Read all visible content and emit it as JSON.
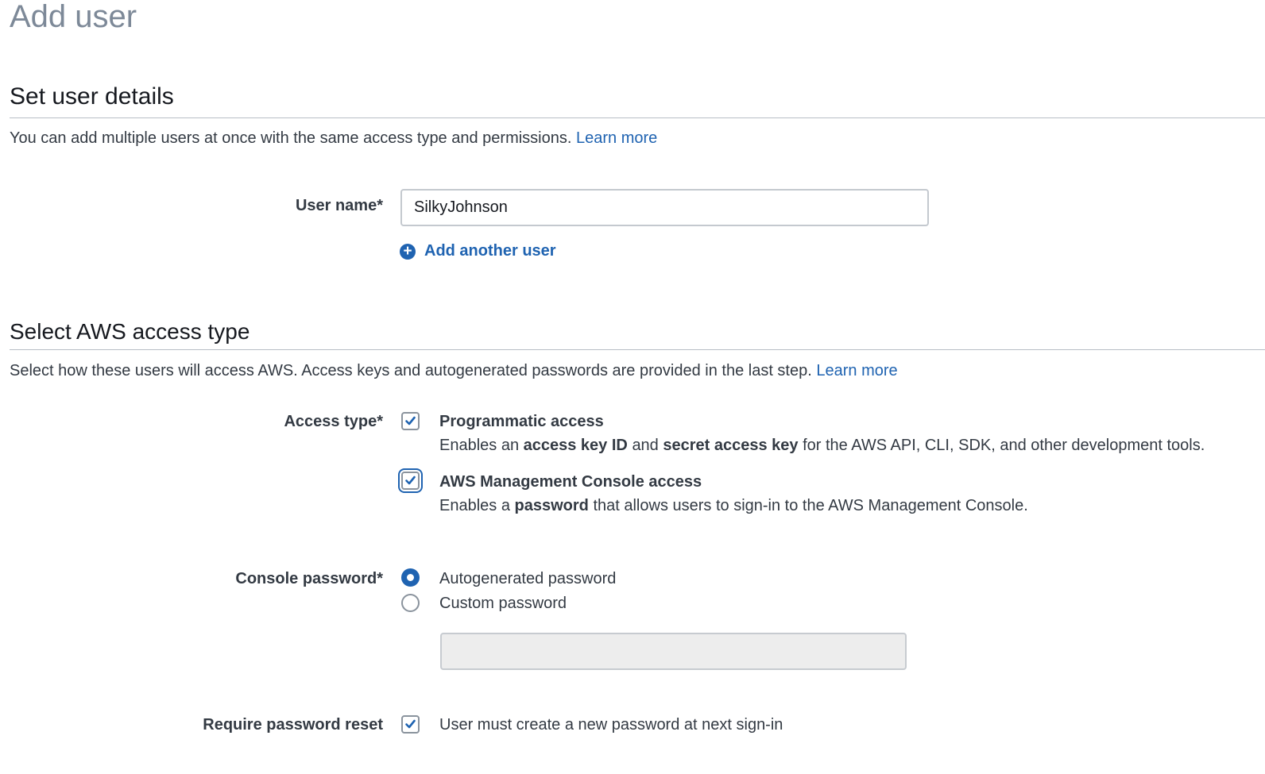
{
  "page": {
    "title": "Add user"
  },
  "user_details": {
    "heading": "Set user details",
    "description": "You can add multiple users at once with the same access type and permissions.",
    "learn_more": "Learn more",
    "user_name_label": "User name*",
    "user_name_value": "SilkyJohnson",
    "add_another_user": "Add another user"
  },
  "access_type": {
    "heading": "Select AWS access type",
    "description": "Select how these users will access AWS. Access keys and autogenerated passwords are provided in the last step.",
    "learn_more": "Learn more",
    "label": "Access type*",
    "programmatic": {
      "checked": true,
      "title": "Programmatic access",
      "desc_1": "Enables an",
      "desc_2": "access key ID",
      "desc_3": "and",
      "desc_4": "secret access key",
      "desc_5": "for the AWS API, CLI, SDK, and other development tools."
    },
    "console": {
      "checked": true,
      "title": "AWS Management Console access",
      "desc_1": "Enables a",
      "desc_2": "password",
      "desc_3": "that allows users to sign-in to the AWS Management Console."
    }
  },
  "console_password": {
    "label": "Console password*",
    "selected": "Autogenerated password",
    "options": [
      "Autogenerated password",
      "Custom password"
    ],
    "custom_value": ""
  },
  "password_reset": {
    "label": "Require password reset",
    "checked": true,
    "option_label": "User must create a new password at next sign-in"
  },
  "colors": {
    "accent": "#1f63b1",
    "title_gray": "#7d8998",
    "text": "#333a43",
    "border": "#c4c9cf",
    "disabled_bg": "#ededed"
  }
}
